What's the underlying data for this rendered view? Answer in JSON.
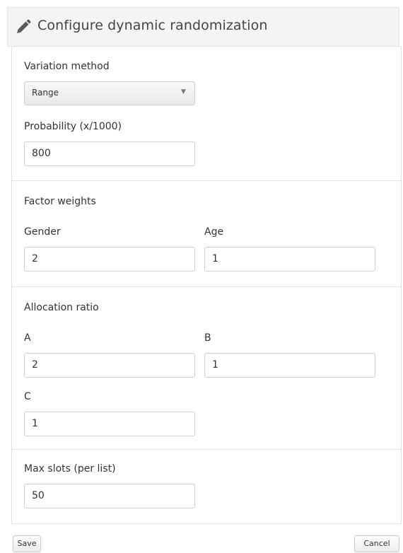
{
  "header": {
    "title": "Configure dynamic randomization",
    "icon": "pencil-icon"
  },
  "variation": {
    "label": "Variation method",
    "selected": "Range"
  },
  "probability": {
    "label": "Probability (x/1000)",
    "value": "800"
  },
  "factor_weights": {
    "heading": "Factor weights",
    "gender_label": "Gender",
    "gender_value": "2",
    "age_label": "Age",
    "age_value": "1"
  },
  "allocation": {
    "heading": "Allocation ratio",
    "a_label": "A",
    "a_value": "2",
    "b_label": "B",
    "b_value": "1",
    "c_label": "C",
    "c_value": "1"
  },
  "max_slots": {
    "label": "Max slots (per list)",
    "value": "50"
  },
  "footer": {
    "save_label": "Save",
    "cancel_label": "Cancel"
  }
}
